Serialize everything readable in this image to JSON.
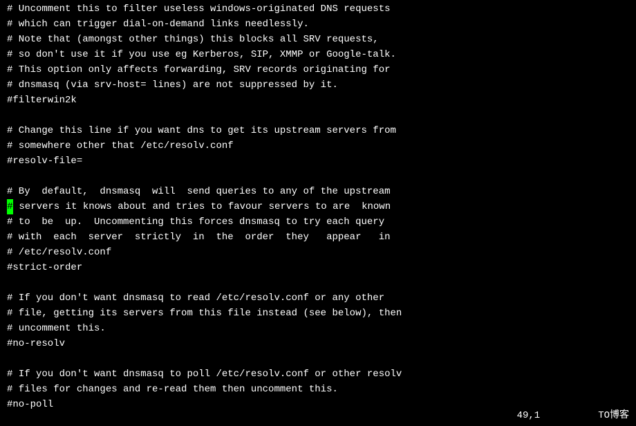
{
  "lines": [
    "# Uncomment this to filter useless windows-originated DNS requests",
    "# which can trigger dial-on-demand links needlessly.",
    "# Note that (amongst other things) this blocks all SRV requests,",
    "# so don't use it if you use eg Kerberos, SIP, XMMP or Google-talk.",
    "# This option only affects forwarding, SRV records originating for",
    "# dnsmasq (via srv-host= lines) are not suppressed by it.",
    "#filterwin2k",
    "",
    "# Change this line if you want dns to get its upstream servers from",
    "# somewhere other that /etc/resolv.conf",
    "#resolv-file=",
    "",
    "# By  default,  dnsmasq  will  send queries to any of the upstream",
    " servers it knows about and tries to favour servers to are  known",
    "# to  be  up.  Uncommenting this forces dnsmasq to try each query",
    "# with  each  server  strictly  in  the  order  they   appear   in",
    "# /etc/resolv.conf",
    "#strict-order",
    "",
    "# If you don't want dnsmasq to read /etc/resolv.conf or any other",
    "# file, getting its servers from this file instead (see below), then",
    "# uncomment this.",
    "#no-resolv",
    "",
    "# If you don't want dnsmasq to poll /etc/resolv.conf or other resolv",
    "# files for changes and re-read them then uncomment this.",
    "#no-poll"
  ],
  "cursor_line_index": 13,
  "cursor_char": "#",
  "status": "49,1          TO博客",
  "watermark": ""
}
